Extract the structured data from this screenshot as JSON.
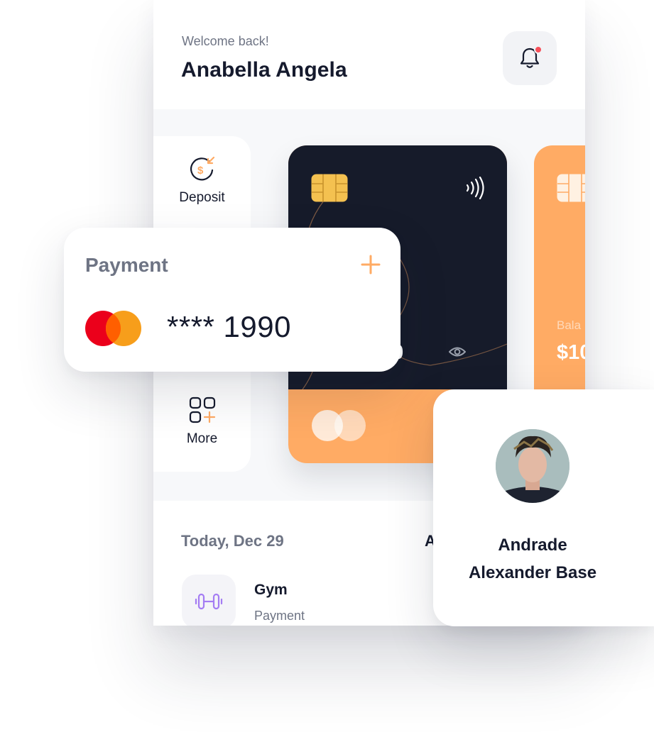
{
  "header": {
    "welcome": "Welcome back!",
    "user_name": "Anabella Angela"
  },
  "quick_actions": [
    {
      "label": "Deposit",
      "icon": "deposit-icon"
    },
    {
      "label": "More",
      "icon": "more-grid-icon"
    }
  ],
  "cards": {
    "dark": {
      "balance_fragment": "00",
      "colors": {
        "top": "#161b2a",
        "bottom": "#ffab64"
      }
    },
    "orange": {
      "balance_label_fragment": "Bala",
      "balance_fragment": "$10"
    }
  },
  "payment": {
    "title": "Payment",
    "masked_number": "**** 1990",
    "add_icon": "plus-icon",
    "brand_icon": "mastercard-logo"
  },
  "transactions": {
    "date": "Today, Dec 29",
    "right_fragment": "A",
    "items": [
      {
        "title": "Gym",
        "subtitle": "Payment",
        "icon": "dumbbell-icon"
      }
    ]
  },
  "profile": {
    "name_line1": "Andrade",
    "name_line2": "Alexander Base"
  },
  "colors": {
    "accent_orange": "#ffab64",
    "dark_navy": "#161b2a",
    "notification_red": "#f64f59",
    "muted_text": "#6e7484",
    "gym_purple": "#a47cf3"
  }
}
